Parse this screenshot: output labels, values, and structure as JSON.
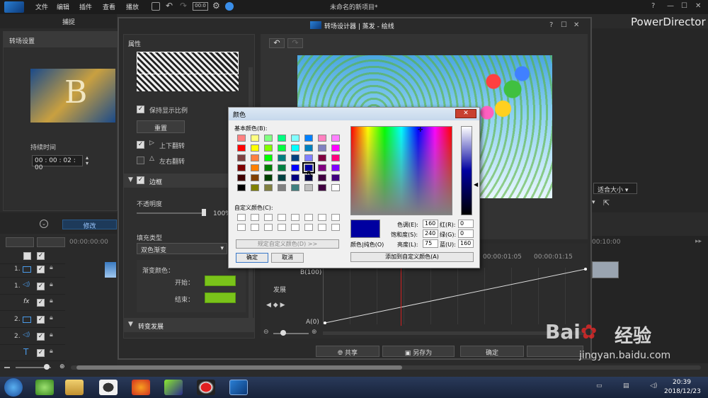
{
  "menu": {
    "file": "文件",
    "edit": "编辑",
    "plugins": "插件",
    "view": "查看",
    "play": "播放",
    "project_title": "未命名的新项目*",
    "brand": "PowerDirector",
    "timecode_icon": "00:0"
  },
  "left_panel": {
    "tab": "捕捉",
    "title": "转场设置",
    "preview_letter": "B",
    "duration_label": "持续时间",
    "duration_value": "00 : 00 : 02 : 00",
    "modify_btn": "修改"
  },
  "designer": {
    "title": "转场设计器 | 蒸发 - 绘线",
    "help": "?",
    "props_title": "属性",
    "keep_ratio": "保持显示比例",
    "reset": "重置",
    "flip_v": "上下翻转",
    "flip_h": "左右翻转",
    "border_section": "边框",
    "opacity_label": "不透明度",
    "opacity_value": "100%",
    "opacity_level": 1.0,
    "fill_type_label": "填充类型",
    "fill_type_value": "双色渐变",
    "gradient_label": "渐变颜色：",
    "start_label": "开始：",
    "end_label": "结束：",
    "start_color": "#7ac31a",
    "end_color": "#7ac31a",
    "progress_section": "转变发展",
    "share": "共享",
    "save_as": "另存为",
    "ok": "确定",
    "fit_size": "适合大小",
    "graph_label": "发展",
    "b100": "B(100)",
    "a0": "A(0)",
    "tc1": "00:00:01:05",
    "tc2": "00:00:01:15"
  },
  "timeline": {
    "tc0": "00:00:00:00",
    "tc_end": "00:10:00",
    "tracks": [
      "1.",
      "1.",
      "fx",
      "2.",
      "2.",
      "T"
    ]
  },
  "color_dialog": {
    "title": "颜色",
    "basic_colors": "基本颜色(B):",
    "custom_colors": "自定义颜色(C):",
    "define_custom": "规定自定义颜色(D) >>",
    "ok": "确定",
    "cancel": "取消",
    "color_solid": "颜色|纯色(O)",
    "add_custom": "添加到自定义颜色(A)",
    "hue_label": "色调(E):",
    "hue": "160",
    "sat_label": "饱和度(S):",
    "sat": "240",
    "lum_label": "亮度(L):",
    "lum": "75",
    "red_label": "红(R):",
    "red": "0",
    "green_label": "绿(G):",
    "green": "0",
    "blue_label": "蓝(U):",
    "blue": "160",
    "selected_color": "#0000a0",
    "swatches": [
      "#ff8080",
      "#ffff80",
      "#80ff80",
      "#00ff80",
      "#80ffff",
      "#0080ff",
      "#ff80c0",
      "#ff80ff",
      "#ff0000",
      "#ffff00",
      "#80ff00",
      "#00ff40",
      "#00ffff",
      "#0080c0",
      "#8080c0",
      "#ff00ff",
      "#804040",
      "#ff8040",
      "#00ff00",
      "#008080",
      "#004080",
      "#8080ff",
      "#800040",
      "#ff0080",
      "#800000",
      "#ff8000",
      "#008000",
      "#008040",
      "#0000ff",
      "#0000a0",
      "#800080",
      "#8000ff",
      "#400000",
      "#804000",
      "#004000",
      "#004040",
      "#000080",
      "#000040",
      "#400040",
      "#400080",
      "#000000",
      "#808000",
      "#808040",
      "#808080",
      "#408080",
      "#c0c0c0",
      "#400040",
      "#ffffff"
    ]
  },
  "taskbar": {
    "time": "20:39",
    "date": "2018/12/23"
  },
  "watermark": {
    "text": "经验",
    "url": "jingyan.baidu.com"
  }
}
